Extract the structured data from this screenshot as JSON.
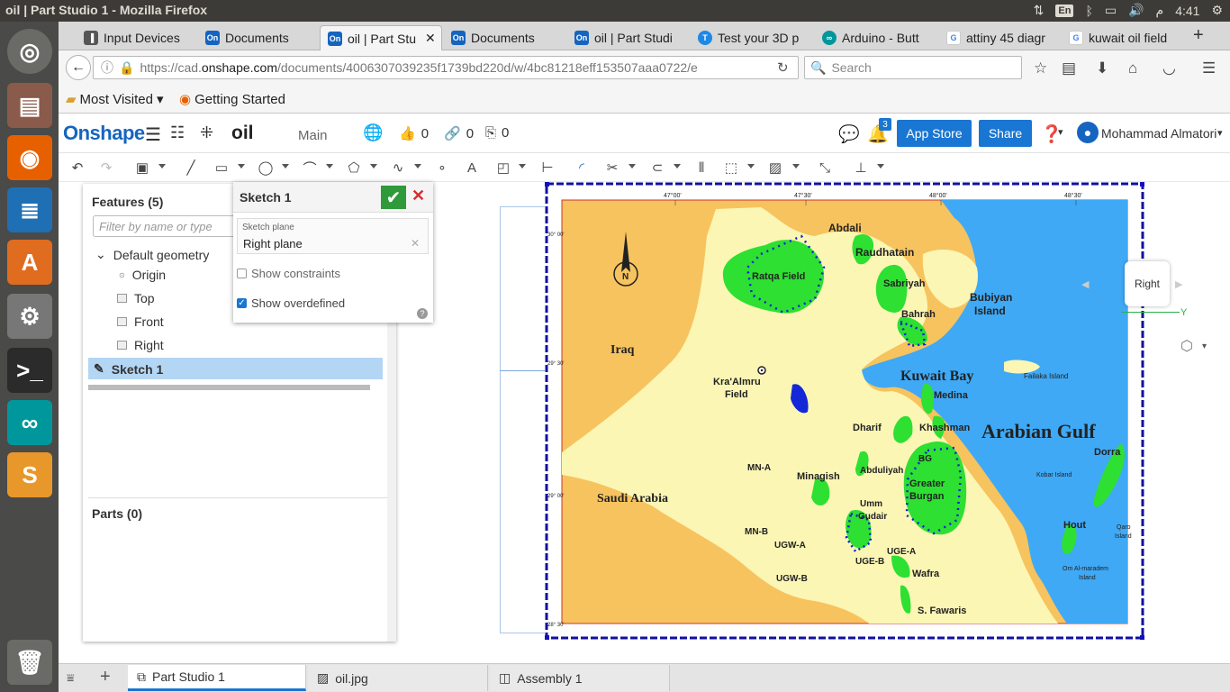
{
  "os": {
    "window_title": "oil | Part Studio 1 - Mozilla Firefox",
    "lang": "En",
    "ampm": "م",
    "clock": "4:41"
  },
  "browser": {
    "tabs": [
      {
        "label": "Input Devices",
        "icon": "input-devices-icon"
      },
      {
        "label": "Documents",
        "icon": "onshape-icon"
      },
      {
        "label": "oil | Part Stu",
        "icon": "onshape-icon",
        "active": true
      },
      {
        "label": "Documents",
        "icon": "onshape-icon"
      },
      {
        "label": "oil | Part Studi",
        "icon": "onshape-icon"
      },
      {
        "label": "Test your 3D p",
        "icon": "test-icon"
      },
      {
        "label": "Arduino - Butt",
        "icon": "arduino-icon"
      },
      {
        "label": "attiny 45 diagr",
        "icon": "google-icon"
      },
      {
        "label": "kuwait oil field",
        "icon": "google-icon"
      }
    ],
    "url_prefix": "https://cad.",
    "url_domain": "onshape.com",
    "url_rest": "/documents/4006307039235f1739bd220d/w/4bc81218eff153507aaa0722/e",
    "search_placeholder": "Search",
    "bookmarks": [
      "Most Visited",
      "Getting Started"
    ]
  },
  "onshape": {
    "logo": "Onshape",
    "doc_name": "oil",
    "branch": "Main",
    "likes": "0",
    "links": "0",
    "copies": "0",
    "notif_count": "3",
    "app_store": "App Store",
    "share": "Share",
    "user": "Mohammad Almatori",
    "features": {
      "title": "Features (5)",
      "filter_placeholder": "Filter by name or type",
      "group": "Default geometry",
      "items": [
        "Origin",
        "Top",
        "Front",
        "Right"
      ],
      "selected": "Sketch 1",
      "parts": "Parts (0)"
    },
    "sketch": {
      "title": "Sketch 1",
      "plane_label": "Sketch plane",
      "plane_value": "Right plane",
      "show_constraints": "Show constraints",
      "show_overdefined": "Show overdefined"
    },
    "view_cube": "Right",
    "axis_y": "Y",
    "bottom_tabs": [
      "Part Studio 1",
      "oil.jpg",
      "Assembly 1"
    ]
  },
  "map": {
    "labels": {
      "abdali": "Abdali",
      "raudhatain": "Raudhatain",
      "ratqa": "Ratqa Field",
      "sabriyah": "Sabriyah",
      "bubiyan": "Bubiyan",
      "island": "Island",
      "bahrah": "Bahrah",
      "iraq": "Iraq",
      "kuwait_bay": "Kuwait Bay",
      "failaka": "Failaka Island",
      "kraalmru": "Kra'Almru",
      "field": "Field",
      "medina": "Medina",
      "dharif": "Dharif",
      "khashman": "Khashman",
      "arabian_gulf": "Arabian Gulf",
      "dorra": "Dorra",
      "mna": "MN-A",
      "minagish": "Minagish",
      "abduliyah": "Abduliyah",
      "bg": "BG",
      "greater": "Greater",
      "burgan": "Burgan",
      "kobar": "Kobar Island",
      "saudi": "Saudi Arabia",
      "umm": "Umm",
      "gudair": "Gudair",
      "mnb": "MN-B",
      "ugwa": "UGW-A",
      "ugea": "UGE-A",
      "ugeb": "UGE-B",
      "ugwb": "UGW-B",
      "wafra": "Wafra",
      "hout": "Hout",
      "qaro": "Qaro",
      "qaro2": "Island",
      "omal": "Om Al-maradem",
      "omal2": "Island",
      "sfawaris": "S. Fawaris",
      "n": "N",
      "lon1": "47°00'",
      "lon2": "47°30'",
      "lon3": "48°00'",
      "lon4": "48°30'",
      "lat1": "30° 00'",
      "lat2": "29° 30'",
      "lat3": "29° 00'",
      "lat4": "28° 30'"
    }
  }
}
